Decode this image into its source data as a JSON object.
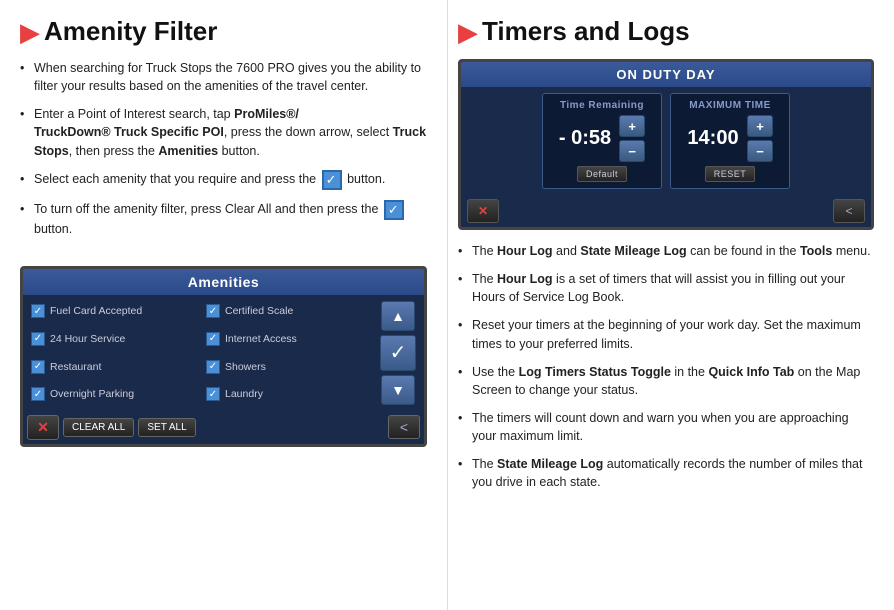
{
  "left": {
    "title": "Amenity Filter",
    "bullets": [
      {
        "id": "b1",
        "text": "When searching for Truck Stops the 7600 PRO gives you the ability to filter your results based on the amenities of the travel center."
      },
      {
        "id": "b2",
        "text_parts": [
          "Enter a Point of Interest search, tap ",
          "ProMiles®/TruckDown® Truck Specific POI",
          ", press the down arrow, select ",
          "Truck Stops",
          ", then press the ",
          "Amenities",
          " button."
        ]
      },
      {
        "id": "b3",
        "text": "Select each amenity that you require and press the",
        "has_check": true,
        "text_after": "button."
      },
      {
        "id": "b4",
        "text": "To turn off the amenity filter, press Clear All and then press the",
        "has_check": true,
        "text_after": "button."
      }
    ],
    "amenities_screen": {
      "header": "Amenities",
      "items": [
        "Fuel Card Accepted",
        "Certified Scale",
        "24 Hour Service",
        "Internet Access",
        "Restaurant",
        "Showers",
        "Overnight Parking",
        "Laundry"
      ],
      "footer_buttons": [
        "×",
        "CLEAR ALL",
        "SET ALL",
        "<"
      ]
    }
  },
  "right": {
    "title": "Timers and Logs",
    "duty_screen": {
      "header": "ON DUTY DAY",
      "left_label": "Time Remaining",
      "left_time": "- 0:58",
      "left_action": "Default",
      "right_label": "MAXIMUM TIME",
      "right_time": "14:00",
      "right_action": "RESET"
    },
    "bullets": [
      {
        "id": "r1",
        "text": "The Hour Log and State Mileage Log can be found in the Tools menu.",
        "bolds": [
          "Hour Log",
          "State Mileage Log",
          "Tools"
        ]
      },
      {
        "id": "r2",
        "text": "The Hour Log is a set of timers that will assist you in filling out your Hours of Service Log Book.",
        "bolds": [
          "Hour Log"
        ]
      },
      {
        "id": "r3",
        "text": "Reset your timers at the beginning of your work day. Set the maximum times to your preferred limits."
      },
      {
        "id": "r4",
        "text": "Use the Log Timers Status Toggle in the Quick Info Tab on the Map Screen to change your status.",
        "bolds": [
          "Log Timers Status Toggle",
          "Quick Info Tab"
        ]
      },
      {
        "id": "r5",
        "text": "The timers will count down and warn you when you are approaching your maximum limit."
      },
      {
        "id": "r6",
        "text": "The State Mileage Log automatically records the number of miles that you drive in each state.",
        "bolds": [
          "State Mileage Log"
        ]
      }
    ]
  }
}
